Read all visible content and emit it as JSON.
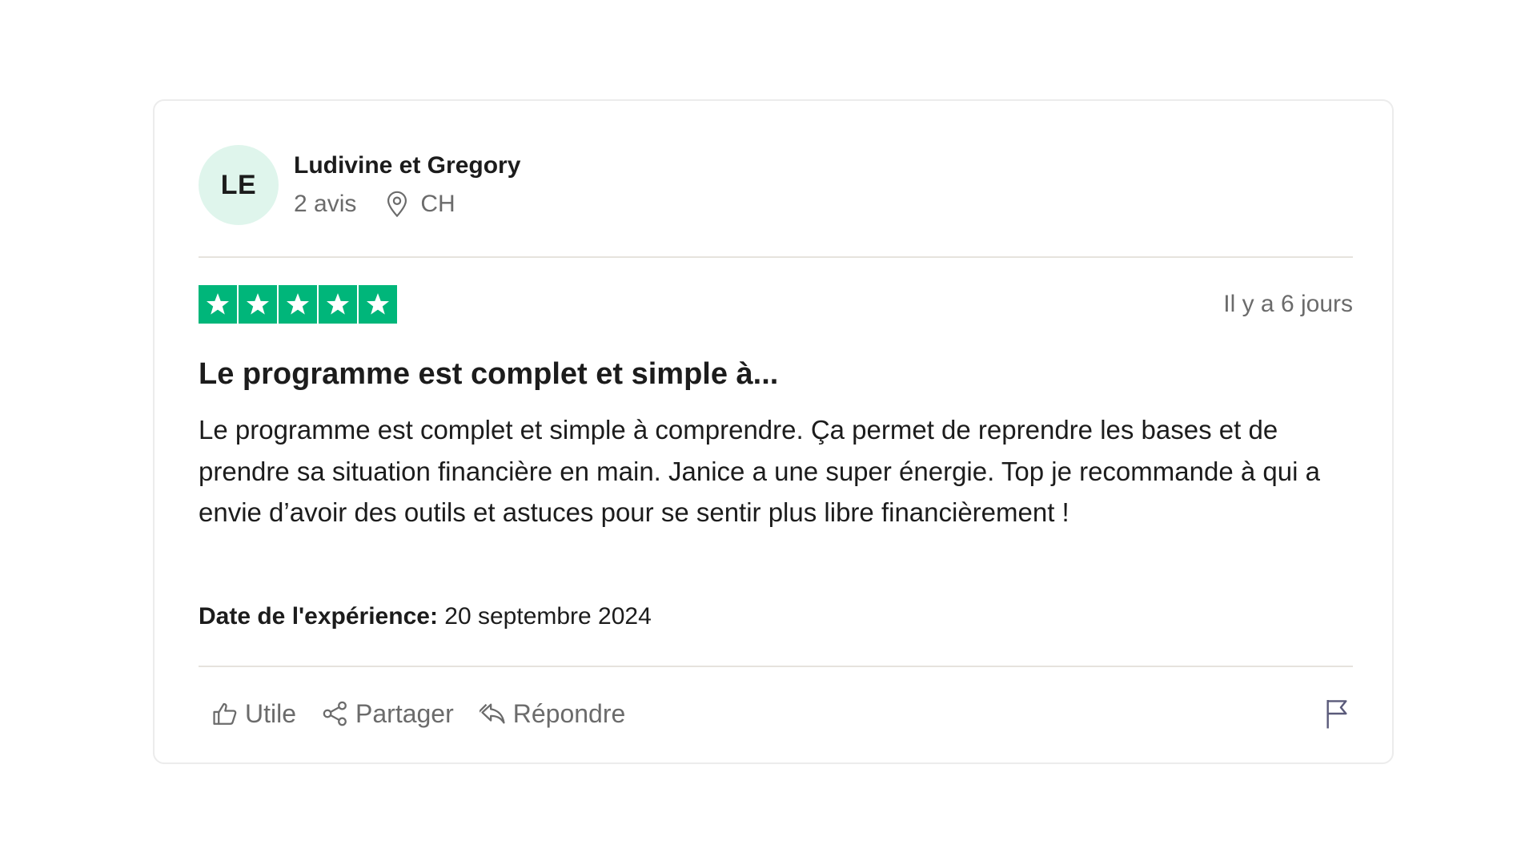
{
  "reviewer": {
    "initials": "LE",
    "name": "Ludivine et Gregory",
    "review_count": "2 avis",
    "location": "CH",
    "avatar_bg": "#dff5ec"
  },
  "review": {
    "rating": 5,
    "rating_max": 5,
    "star_color": "#00b67a",
    "relative_date": "Il y a 6 jours",
    "title": "Le programme est complet et simple à...",
    "body": "Le programme est complet et simple à comprendre. Ça permet de reprendre les bases et de prendre sa situation financière en main. Janice a une super énergie. Top je recommande à qui a envie d’avoir des outils et astuces pour se sentir plus libre financièrement !",
    "experience_label": "Date de l'expérience:",
    "experience_date": "20 septembre 2024"
  },
  "actions": {
    "useful_label": "Utile",
    "share_label": "Partager",
    "reply_label": "Répondre"
  },
  "icons": {
    "location": "map-pin-icon",
    "useful": "thumbs-up-icon",
    "share": "share-icon",
    "reply": "reply-icon",
    "report": "flag-icon",
    "star": "star-icon"
  }
}
